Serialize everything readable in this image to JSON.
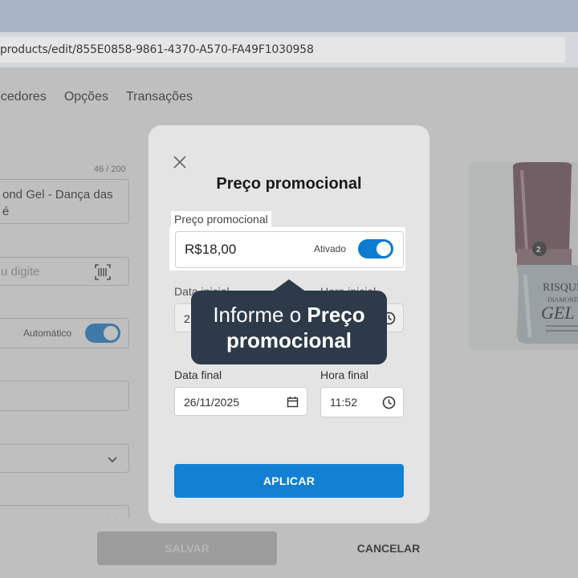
{
  "browser": {
    "url": "products/edit/855E0858-9861-4370-A570-FA49F1030958"
  },
  "page": {
    "tabs": [
      "ecedores",
      "Opções",
      "Transações"
    ],
    "name_counter": "46 / 200",
    "name_value_line1": "ond Gel - Dança das",
    "name_value_line2": "é",
    "code_placeholder": "u digite",
    "auto_label": "Automático",
    "product_image_icon": "nail-polish-bottle-image"
  },
  "footer": {
    "save_label": "SALVAR",
    "cancel_label": "CANCELAR"
  },
  "modal": {
    "title": "Preço promocional",
    "price_field_label": "Preço promocional",
    "price_value": "R$18,00",
    "toggle_label": "Ativado",
    "toggle_on": true,
    "start_date_label": "Data inicial",
    "start_time_label": "Hora inicial",
    "start_date_value": "2",
    "end_date_label": "Data final",
    "end_date_value": "26/11/2025",
    "end_time_label": "Hora final",
    "end_time_value": "11:52",
    "apply_label": "APLICAR"
  },
  "tooltip": {
    "text_normal": "Informe o ",
    "text_bold_1": "Preço",
    "text_bold_2": "promocional"
  },
  "colors": {
    "accent": "#1281d4",
    "toggle": "#0c7bd1",
    "tooltip_bg": "#2d3a4a"
  }
}
